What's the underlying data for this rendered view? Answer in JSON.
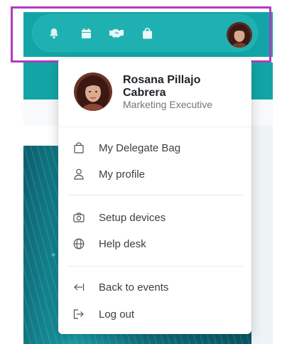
{
  "header": {
    "icons": [
      {
        "name": "bell-icon"
      },
      {
        "name": "calendar-icon"
      },
      {
        "name": "handshake-icon"
      },
      {
        "name": "bag-icon"
      }
    ],
    "icon_color": "#ffffff",
    "accent": "#13a5a6"
  },
  "profile": {
    "name": "Rosana Pillajo Cabrera",
    "role": "Marketing Executive"
  },
  "menu": {
    "groups": [
      [
        {
          "label": "My Delegate Bag",
          "icon": "bag-outline-icon"
        },
        {
          "label": "My profile",
          "icon": "user-icon"
        }
      ],
      [
        {
          "label": "Setup devices",
          "icon": "camera-icon"
        },
        {
          "label": "Help desk",
          "icon": "globe-icon"
        }
      ],
      [
        {
          "label": "Back to events",
          "icon": "arrow-back-icon"
        },
        {
          "label": "Log out",
          "icon": "logout-icon"
        }
      ]
    ]
  },
  "highlight_color": "#b03bbe"
}
